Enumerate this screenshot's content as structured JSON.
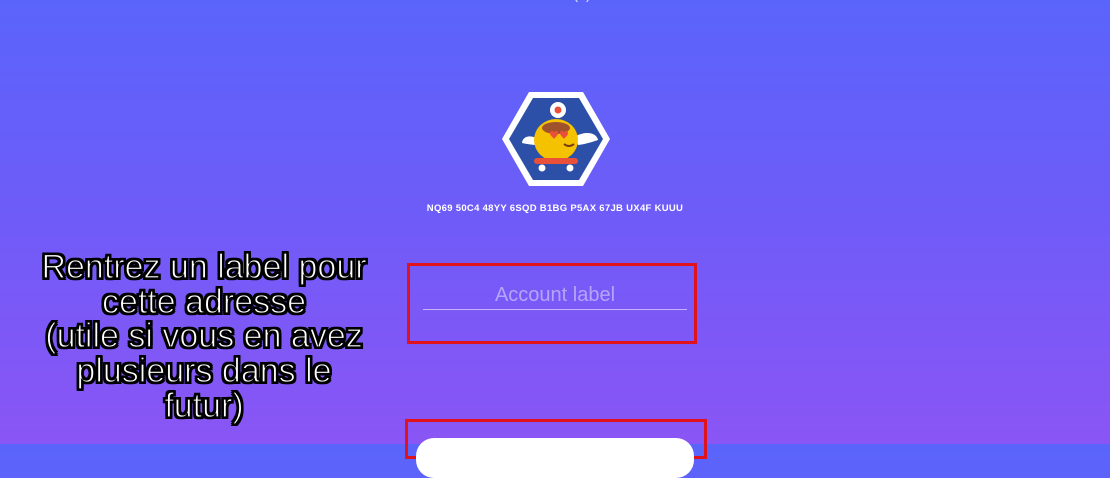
{
  "header": {
    "title_fragment": "( )"
  },
  "account": {
    "avatar_icon": "skateboarding-chick-avatar-icon",
    "address": "NQ69 50C4 48YY 6SQD B1BG P5AX 67JB UX4F KUUU"
  },
  "form": {
    "label_input": {
      "placeholder": "Account label",
      "value": ""
    }
  },
  "annotation": {
    "lines": [
      "Rentrez un label pour",
      "cette adresse",
      "(utile si vous en avez",
      "plusieurs dans le",
      "futur)"
    ],
    "highlight_color": "#e0131d"
  },
  "colors": {
    "background_top": "#5a64fb",
    "background_bottom": "#8a55f5",
    "avatar_bg": "#2c4fa8"
  }
}
